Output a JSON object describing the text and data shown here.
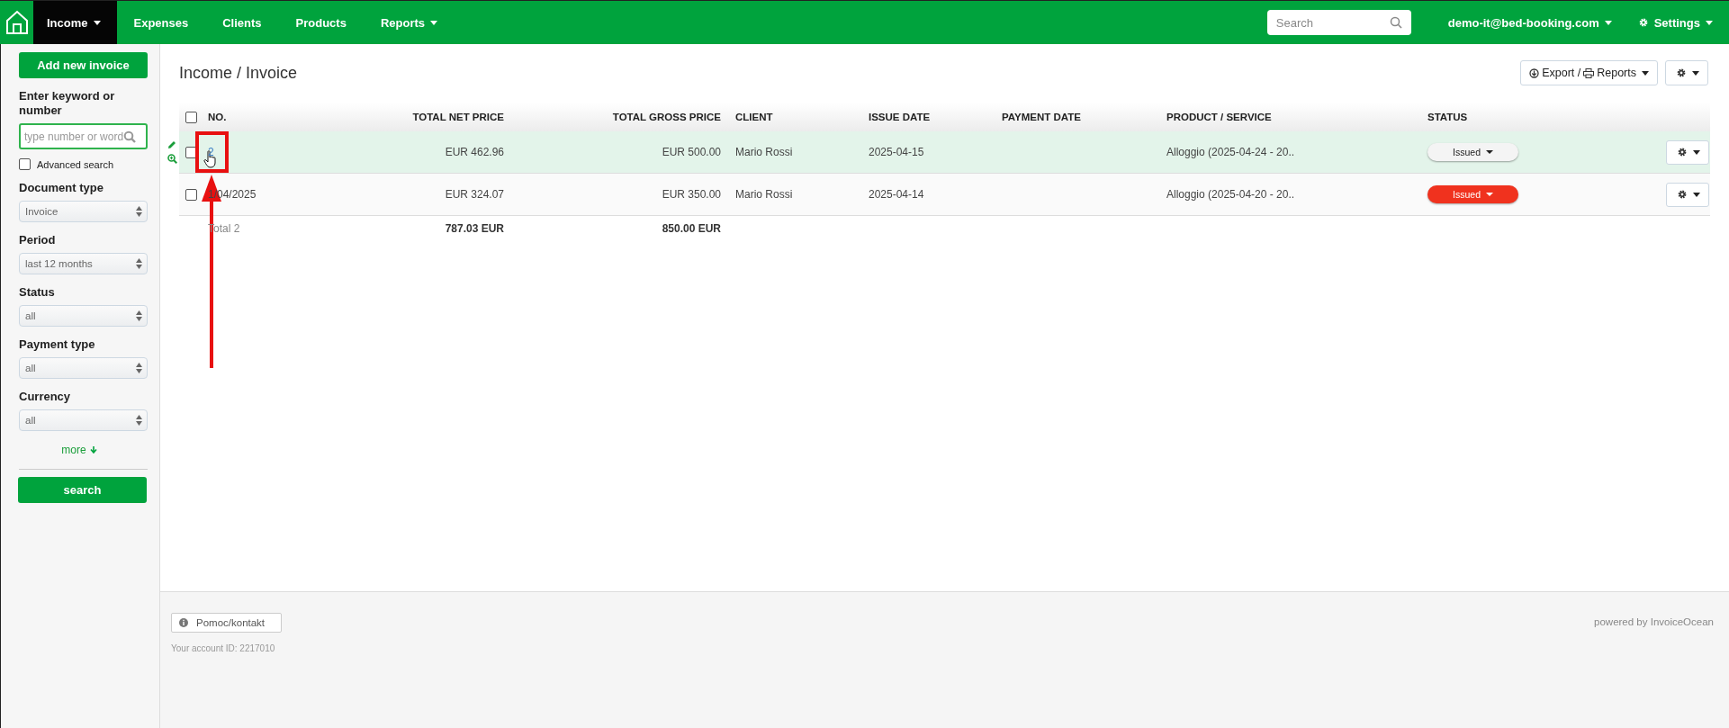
{
  "nav": {
    "items": [
      {
        "label": "Income",
        "selected": true,
        "dropdown": true
      },
      {
        "label": "Expenses",
        "selected": false,
        "dropdown": false
      },
      {
        "label": "Clients",
        "selected": false,
        "dropdown": false
      },
      {
        "label": "Products",
        "selected": false,
        "dropdown": false
      },
      {
        "label": "Reports",
        "selected": false,
        "dropdown": true
      }
    ],
    "search": {
      "placeholder": "Search"
    },
    "user": "demo-it@bed-booking.com",
    "settings": "Settings"
  },
  "sidebar": {
    "add_button": "Add new invoice",
    "keyword_label": "Enter keyword or number",
    "keyword_placeholder": "type number or word",
    "advanced": {
      "label": "Advanced search",
      "checked": false
    },
    "filters": [
      {
        "label": "Document type",
        "value": "Invoice"
      },
      {
        "label": "Period",
        "value": "last 12 months"
      },
      {
        "label": "Status",
        "value": "all"
      },
      {
        "label": "Payment type",
        "value": "all"
      },
      {
        "label": "Currency",
        "value": "all"
      }
    ],
    "more": "more",
    "search_button": "search"
  },
  "page": {
    "title": "Income / Invoice",
    "export_button": "Export / ",
    "reports_button": "Reports"
  },
  "table": {
    "header_checked": false,
    "columns": [
      "NO.",
      "TOTAL NET PRICE",
      "TOTAL GROSS PRICE",
      "CLIENT",
      "ISSUE DATE",
      "PAYMENT DATE",
      "PRODUCT / SERVICE",
      "STATUS"
    ],
    "rows": [
      {
        "checked": false,
        "highlighted": true,
        "no": "2",
        "net": "EUR 462.96",
        "gross": "EUR 500.00",
        "client": "Mario Rossi",
        "issue_date": "2025-04-15",
        "product": "Alloggio (2025-04-24 - 20..",
        "status": {
          "label": "Issued",
          "color": "#f4f4f4"
        }
      },
      {
        "checked": false,
        "highlighted": false,
        "no": "1/04/2025",
        "net": "EUR 324.07",
        "gross": "EUR 350.00",
        "client": "Mario Rossi",
        "issue_date": "2025-04-14",
        "product": "Alloggio (2025-04-20 - 20..",
        "status": {
          "label": "Issued",
          "color": "#f0321e"
        }
      }
    ],
    "total": {
      "label": "Total 2",
      "net": "787.03 EUR",
      "gross": "850.00 EUR"
    }
  },
  "footer": {
    "help_button": "Pomoc/kontakt",
    "account": "Your account ID: 2217010",
    "powered": "powered by InvoiceOcean"
  }
}
